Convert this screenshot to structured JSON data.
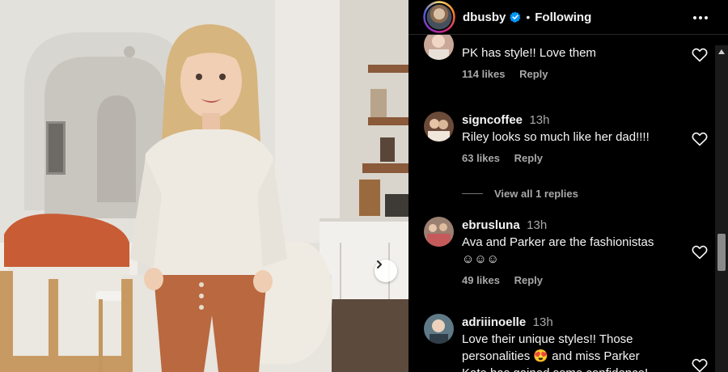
{
  "post": {
    "username": "dbusby",
    "verified": true,
    "follow_state": "Following",
    "dot": "•"
  },
  "comments": [
    {
      "username": "",
      "time": "",
      "text": "PK has style!! Love them",
      "likes": "114 likes",
      "reply": "Reply"
    },
    {
      "username": "signcoffee",
      "time": "13h",
      "text": "Riley looks so much like her dad!!!!",
      "likes": "63 likes",
      "reply": "Reply",
      "view_replies": "View all 1 replies"
    },
    {
      "username": "ebrusluna",
      "time": "13h",
      "text": "Ava and Parker are the fashionistas",
      "text_line2": "☺☺☺",
      "likes": "49 likes",
      "reply": "Reply"
    },
    {
      "username": "adriiinoelle",
      "time": "13h",
      "text": "Love their unique styles!! Those",
      "text_line2": "personalities 😍 and miss Parker",
      "text_line3": "Kate has gained some confidence!"
    }
  ],
  "colors": {
    "panel_bg": "#000000",
    "text_primary": "#f5f5f5",
    "text_secondary": "#a8a8a8",
    "verified_blue": "#0095f6"
  },
  "icons": {
    "more": "more-horizontal-icon",
    "heart": "heart-outline-icon",
    "verified": "verified-badge-icon",
    "next": "chevron-right-icon"
  }
}
